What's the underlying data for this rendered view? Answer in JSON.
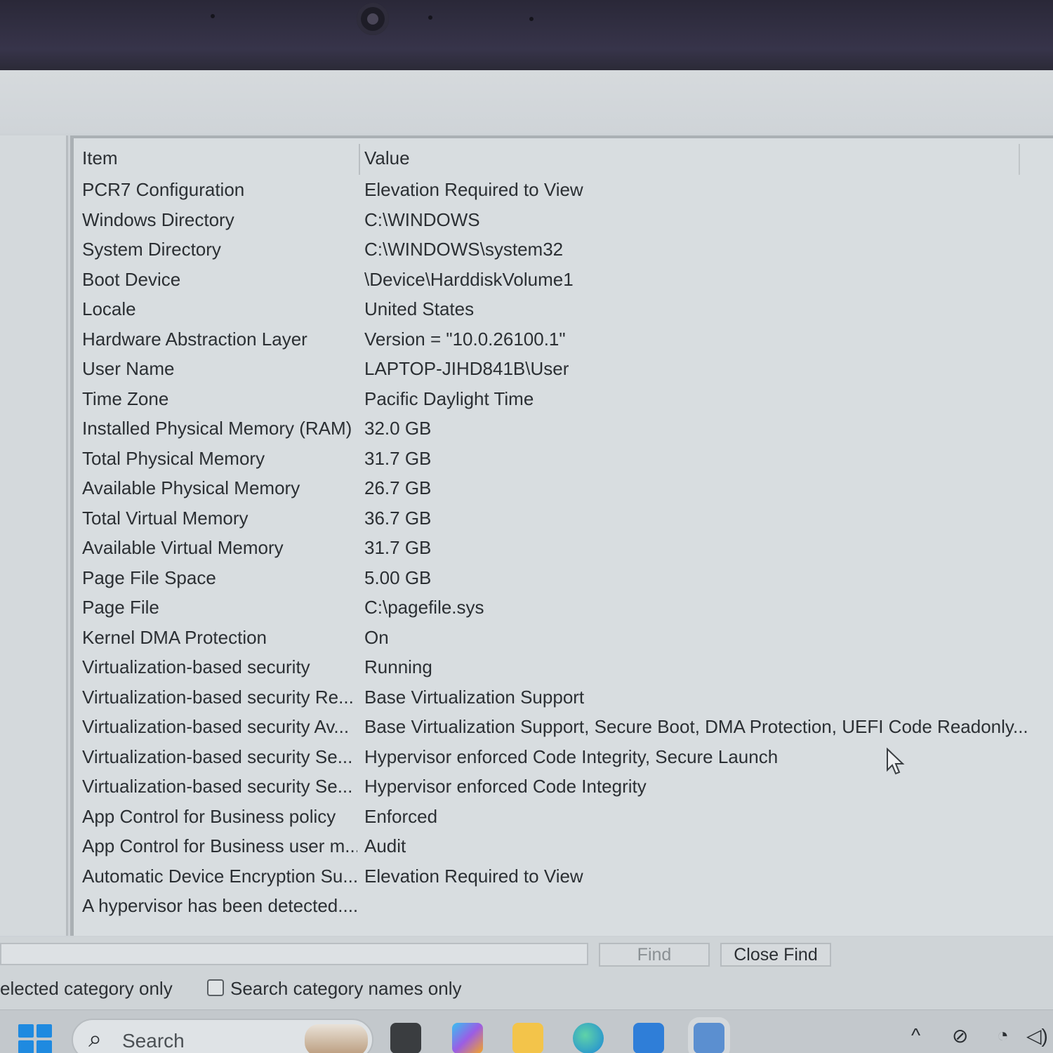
{
  "list": {
    "header": {
      "item": "Item",
      "value": "Value"
    },
    "rows": [
      {
        "item": "PCR7 Configuration",
        "value": "Elevation Required to View"
      },
      {
        "item": "Windows Directory",
        "value": "C:\\WINDOWS"
      },
      {
        "item": "System Directory",
        "value": "C:\\WINDOWS\\system32"
      },
      {
        "item": "Boot Device",
        "value": "\\Device\\HarddiskVolume1"
      },
      {
        "item": "Locale",
        "value": "United States"
      },
      {
        "item": "Hardware Abstraction Layer",
        "value": "Version = \"10.0.26100.1\""
      },
      {
        "item": "User Name",
        "value": "LAPTOP-JIHD841B\\User"
      },
      {
        "item": "Time Zone",
        "value": "Pacific Daylight Time"
      },
      {
        "item": "Installed Physical Memory (RAM)",
        "value": "32.0 GB"
      },
      {
        "item": "Total Physical Memory",
        "value": "31.7 GB"
      },
      {
        "item": "Available Physical Memory",
        "value": "26.7 GB"
      },
      {
        "item": "Total Virtual Memory",
        "value": "36.7 GB"
      },
      {
        "item": "Available Virtual Memory",
        "value": "31.7 GB"
      },
      {
        "item": "Page File Space",
        "value": "5.00 GB"
      },
      {
        "item": "Page File",
        "value": "C:\\pagefile.sys"
      },
      {
        "item": "Kernel DMA Protection",
        "value": "On"
      },
      {
        "item": "Virtualization-based security",
        "value": "Running"
      },
      {
        "item": "Virtualization-based security Re...",
        "value": "Base Virtualization Support"
      },
      {
        "item": "Virtualization-based security Av...",
        "value": "Base Virtualization Support, Secure Boot, DMA Protection, UEFI Code Readonly..."
      },
      {
        "item": "Virtualization-based security Se...",
        "value": "Hypervisor enforced Code Integrity, Secure Launch"
      },
      {
        "item": "Virtualization-based security Se...",
        "value": "Hypervisor enforced Code Integrity"
      },
      {
        "item": "App Control for Business policy",
        "value": "Enforced"
      },
      {
        "item": "App Control for Business user m...",
        "value": "Audit"
      },
      {
        "item": "Automatic Device Encryption Su...",
        "value": "Elevation Required to View"
      },
      {
        "item": "A hypervisor has been detected....",
        "value": ""
      }
    ]
  },
  "find": {
    "input_value": "",
    "find_label": "Find",
    "close_find_label": "Close Find",
    "option_selected_category": "elected category only",
    "option_search_names": "Search category names only",
    "search_names_checked": false
  },
  "taskbar": {
    "search_placeholder": "Search",
    "search_glyph": "⌕",
    "icons": [
      "start-icon",
      "weather-icon",
      "terminal-icon",
      "copilot-m365-icon",
      "file-explorer-icon",
      "edge-icon",
      "store-icon",
      "system-information-icon"
    ],
    "tray": {
      "chevron": "^",
      "cloud_off": "⊘",
      "wifi": "◔",
      "volume": "◁)"
    }
  },
  "colors": {
    "list_bg": "#d8dde0",
    "text": "#2b2f33",
    "accent_blue": "#1f8ae0"
  }
}
